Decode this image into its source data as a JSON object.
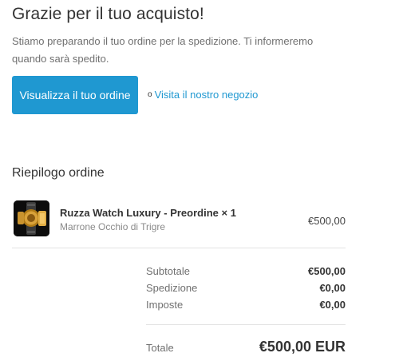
{
  "header": {
    "title": "Grazie per il tuo acquisto!",
    "subtitle": "Stiamo preparando il tuo ordine per la spedizione. Ti informeremo quando sarà spedito."
  },
  "actions": {
    "view_order_label": "Visualizza il tuo ordine",
    "or_symbol": "o",
    "visit_store_label": "Visita il nostro negozio",
    "accent_color": "#1f98d1"
  },
  "summary": {
    "heading": "Riepilogo ordine",
    "items": [
      {
        "name": "Ruzza Watch Luxury - Preordine × 1",
        "variant": "Marrone Occhio di Trigre",
        "price": "€500,00",
        "image_icon": "watch-icon"
      }
    ],
    "subtotal_label": "Subtotale",
    "subtotal_value": "€500,00",
    "shipping_label": "Spedizione",
    "shipping_value": "€0,00",
    "taxes_label": "Imposte",
    "taxes_value": "€0,00",
    "total_label": "Totale",
    "total_value": "€500,00 EUR"
  }
}
